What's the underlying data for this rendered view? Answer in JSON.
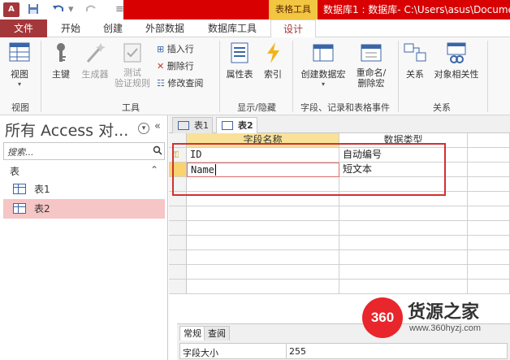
{
  "titlebar": {
    "app_icon": "A",
    "quick_access": {
      "save_icon": "save-icon",
      "undo_icon": "undo-icon",
      "redo_icon": "redo-icon"
    },
    "contextual_tab": "表格工具",
    "title": "数据库1 : 数据库- C:\\Users\\asus\\Docume"
  },
  "ribbon_tabs": [
    "文件",
    "开始",
    "创建",
    "外部数据",
    "数据库工具",
    "设计"
  ],
  "ribbon": {
    "groups": [
      {
        "label": "视图",
        "buttons": [
          {
            "label": "视图",
            "icon": "view-icon"
          }
        ]
      },
      {
        "label": "工具",
        "buttons": [
          {
            "label": "主键",
            "icon": "key-icon"
          },
          {
            "label": "生成器",
            "icon": "wand-icon"
          },
          {
            "label": "测试\n验证规则",
            "icon": "test-icon"
          }
        ],
        "small": [
          "插入行",
          "删除行",
          "修改查阅"
        ]
      },
      {
        "label": "显示/隐藏",
        "buttons": [
          {
            "label": "属性表",
            "icon": "property-sheet-icon"
          },
          {
            "label": "索引",
            "icon": "index-icon"
          }
        ]
      },
      {
        "label": "字段、记录和表格事件",
        "buttons": [
          {
            "label": "创建数据宏",
            "icon": "data-macro-icon"
          },
          {
            "label": "重命名/\n删除宏",
            "icon": "rename-macro-icon"
          }
        ]
      },
      {
        "label": "关系",
        "buttons": [
          {
            "label": "关系",
            "icon": "relationships-icon"
          },
          {
            "label": "对象相关性",
            "icon": "object-dependencies-icon"
          }
        ]
      }
    ]
  },
  "nav_pane": {
    "title": "所有 Access 对...",
    "search_placeholder": "搜索...",
    "section": "表",
    "items": [
      "表1",
      "表2"
    ]
  },
  "doc_tabs": [
    "表1",
    "表2"
  ],
  "grid": {
    "columns": [
      "字段名称",
      "数据类型"
    ],
    "rows": [
      {
        "name": "ID",
        "type": "自动编号",
        "primary_key": true
      },
      {
        "name": "Name",
        "type": "短文本",
        "primary_key": false
      }
    ]
  },
  "properties": {
    "tabs": [
      "常规",
      "查阅"
    ],
    "row": {
      "label": "字段大小",
      "value": "255"
    }
  },
  "watermark": {
    "logo": "360",
    "title": "货源之家",
    "url": "www.360hyzj.com"
  },
  "colors": {
    "accent": "#a4373a",
    "title_red": "#d80000",
    "tool_tab": "#f3c642",
    "highlight": "#f9e199",
    "selected_nav": "#f6c5c5"
  }
}
